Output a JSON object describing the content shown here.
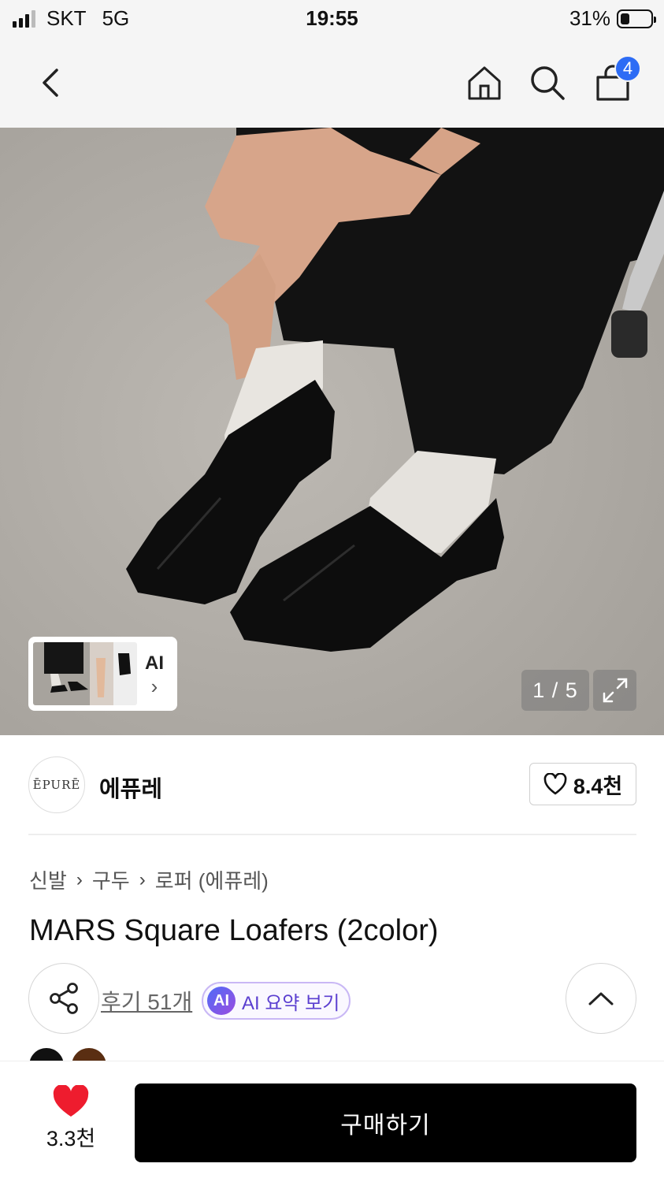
{
  "status_bar": {
    "carrier": "SKT",
    "network": "5G",
    "time": "19:55",
    "battery": "31%",
    "battery_level": 0.31
  },
  "nav": {
    "back_icon": "chevron-left-icon",
    "home_icon": "home-icon",
    "search_icon": "search-icon",
    "cart_icon": "shopping-bag-icon",
    "cart_count": "4",
    "badge_color": "#2d6cf5"
  },
  "hero": {
    "ai_label": "AI",
    "ai_chevron": "›",
    "counter": "1 / 5",
    "expand_icon": "expand-icon"
  },
  "brand": {
    "logo_text": "ĒPURĒ",
    "name": "에퓨레",
    "likes": "8.4천"
  },
  "breadcrumb": [
    "신발",
    "구두",
    "로퍼 (에퓨레)"
  ],
  "product": {
    "title": "MARS Square Loafers (2color)",
    "reviews": "후기 51개",
    "ai_badge": "AI",
    "ai_summary": "AI 요약 보기",
    "swatch_colors": [
      "#111111",
      "#5a2e12"
    ]
  },
  "bottom": {
    "wish_count": "3.3천",
    "heart_color": "#ee1c2e",
    "buy_label": "구매하기"
  }
}
